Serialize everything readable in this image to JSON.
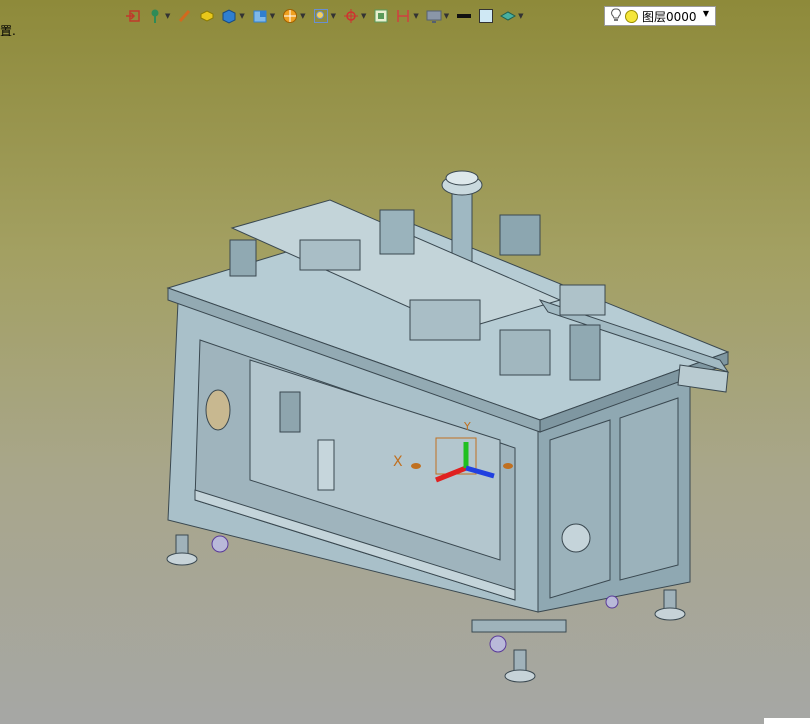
{
  "corner_label": "置.",
  "toolbar": {
    "icons": [
      {
        "name": "import-icon",
        "color": "#c0392b"
      },
      {
        "name": "pin-icon",
        "color": "#2e8b57"
      },
      {
        "name": "brush-icon",
        "color": "#d2691e"
      },
      {
        "name": "yellow-solid-icon",
        "color": "#e8c81a"
      },
      {
        "name": "blue-cube-icon",
        "color": "#2f7fd0"
      },
      {
        "name": "cube-view-icon",
        "color": "#2f7fd0"
      },
      {
        "name": "sphere-icon",
        "color": "#f0a020"
      },
      {
        "name": "zoom-fit-icon",
        "color": "#6a8fd0"
      },
      {
        "name": "crosshair-icon",
        "color": "#d03030"
      },
      {
        "name": "grid-frame-icon",
        "color": "#5a9a5a"
      },
      {
        "name": "dimension-icon",
        "color": "#d04040"
      },
      {
        "name": "monitor-icon",
        "color": "#556070"
      },
      {
        "name": "line-weight-icon",
        "color": "#111111"
      },
      {
        "name": "color-square-icon",
        "color": "#cfe8f4"
      },
      {
        "name": "layer-stack-icon",
        "color": "#48b0a0"
      }
    ],
    "layer_select": {
      "value": "图层0000"
    }
  },
  "viewport": {
    "background_top": "#8e8a3a",
    "background_bottom": "#a6a7a5",
    "axis_label_x": "X",
    "axis_label_y": "Y"
  }
}
